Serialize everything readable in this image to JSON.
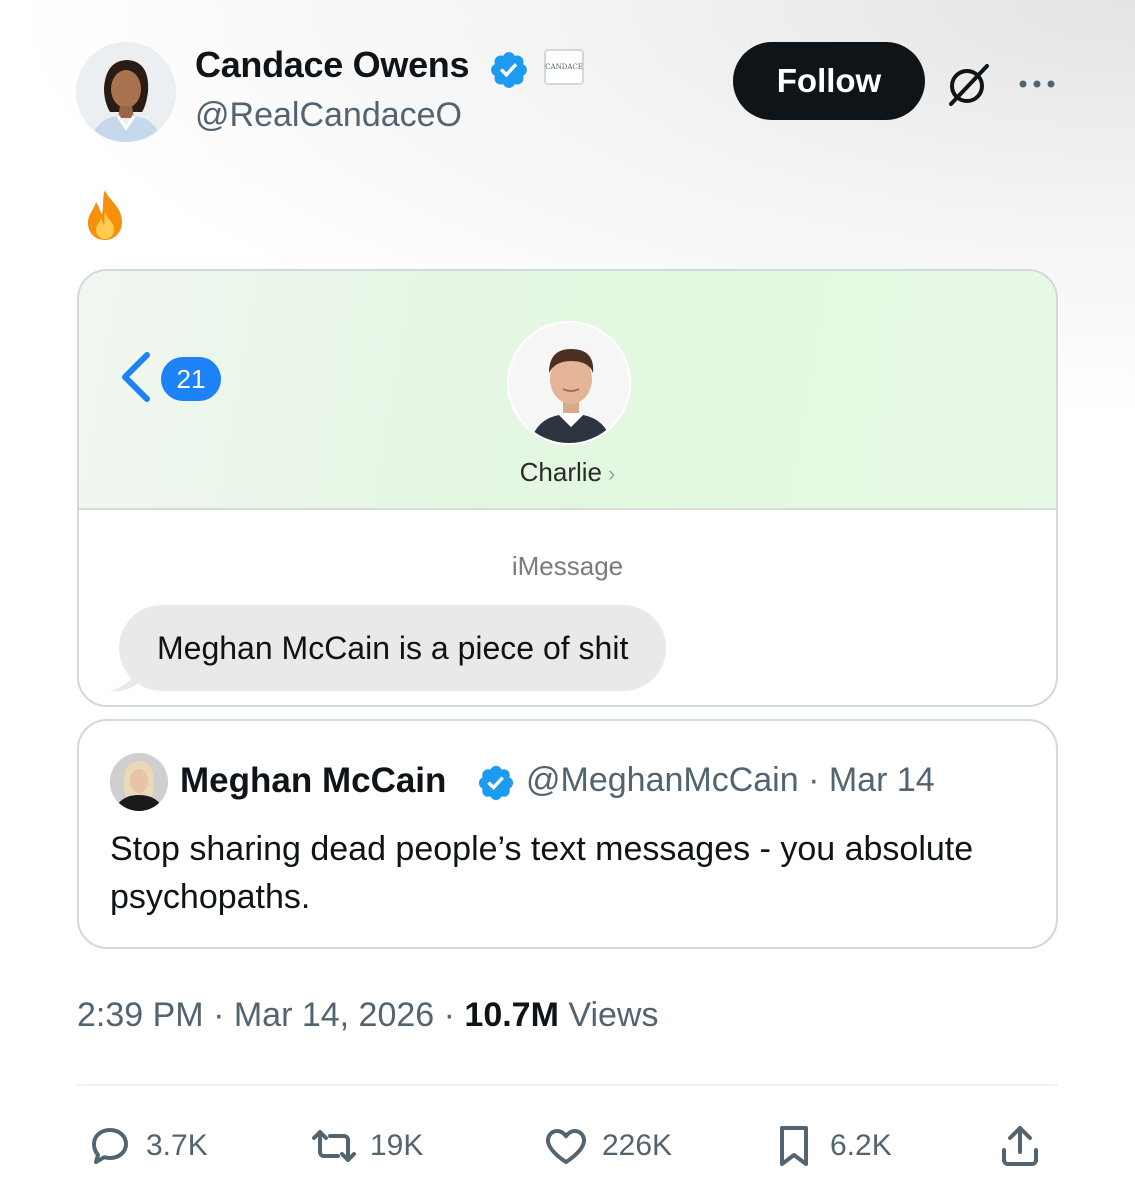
{
  "author": {
    "name": "Candace Owens",
    "handle": "@RealCandaceO",
    "affiliate_badge_text": "CANDACE"
  },
  "header": {
    "follow_label": "Follow"
  },
  "post": {
    "emoji": "fire"
  },
  "imessage": {
    "unread_count": "21",
    "contact_name": "Charlie",
    "service_label": "iMessage",
    "message": "Meghan McCain is a piece of shit"
  },
  "quote": {
    "name": "Meghan McCain",
    "handle": "@MeghanMcCain",
    "date": "Mar 14",
    "text": "Stop sharing dead people’s text messages - you absolute psychopaths."
  },
  "meta": {
    "time": "2:39 PM",
    "date": "Mar 14, 2026",
    "views_count": "10.7M",
    "views_label": "Views"
  },
  "actions": {
    "replies": "3.7K",
    "reposts": "19K",
    "likes": "226K",
    "bookmarks": "6.2K"
  },
  "colors": {
    "verified": "#1d9bf0",
    "follow_bg": "#0f1419",
    "imessage_blue": "#1d82f5",
    "secondary_text": "#536471"
  }
}
